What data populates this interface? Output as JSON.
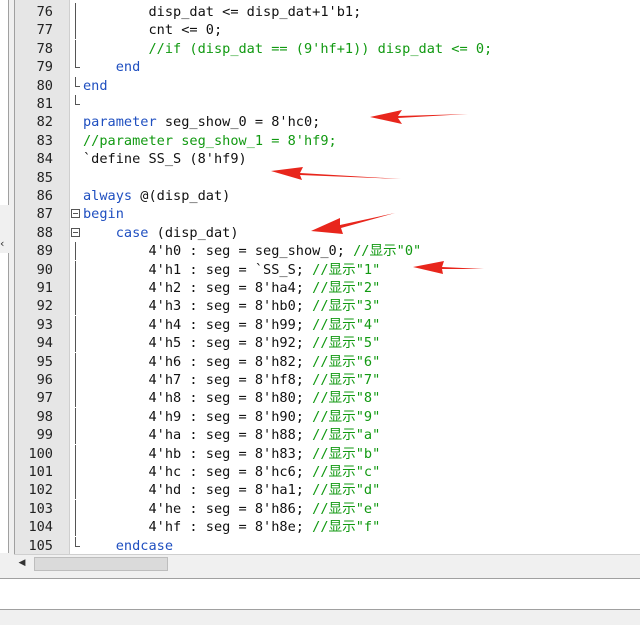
{
  "editor": {
    "lines": [
      {
        "num": "76",
        "fold": "line",
        "segments": [
          {
            "t": "        disp_dat <= disp_dat+1'b1;",
            "c": ""
          }
        ]
      },
      {
        "num": "77",
        "fold": "line",
        "segments": [
          {
            "t": "        cnt <= 0;",
            "c": ""
          }
        ]
      },
      {
        "num": "78",
        "fold": "line",
        "segments": [
          {
            "t": "        //if (disp_dat == (9'hf+1)) disp_dat <= 0;",
            "c": "cm"
          }
        ]
      },
      {
        "num": "79",
        "fold": "end",
        "segments": [
          {
            "t": "    ",
            "c": ""
          },
          {
            "t": "end",
            "c": "kw"
          }
        ]
      },
      {
        "num": "80",
        "fold": "end",
        "segments": [
          {
            "t": "end",
            "c": "kw"
          }
        ]
      },
      {
        "num": "81",
        "fold": "end",
        "segments": []
      },
      {
        "num": "82",
        "fold": "",
        "segments": [
          {
            "t": "parameter",
            "c": "kw"
          },
          {
            "t": " seg_show_0 = 8'hc0;",
            "c": ""
          }
        ]
      },
      {
        "num": "83",
        "fold": "",
        "segments": [
          {
            "t": "//parameter seg_show_1 = 8'hf9;",
            "c": "cm"
          }
        ]
      },
      {
        "num": "84",
        "fold": "",
        "segments": [
          {
            "t": "`define SS_S (8'hf9)",
            "c": ""
          }
        ]
      },
      {
        "num": "85",
        "fold": "",
        "segments": []
      },
      {
        "num": "86",
        "fold": "",
        "segments": [
          {
            "t": "always",
            "c": "kw"
          },
          {
            "t": " @(disp_dat)",
            "c": ""
          }
        ]
      },
      {
        "num": "87",
        "fold": "box",
        "segments": [
          {
            "t": "begin",
            "c": "kw"
          }
        ]
      },
      {
        "num": "88",
        "fold": "box",
        "segments": [
          {
            "t": "    ",
            "c": ""
          },
          {
            "t": "case",
            "c": "kw"
          },
          {
            "t": " (disp_dat)",
            "c": ""
          }
        ]
      },
      {
        "num": "89",
        "fold": "line",
        "segments": [
          {
            "t": "        4'h0 : seg = seg_show_0; ",
            "c": ""
          },
          {
            "t": "//显示\"0\"",
            "c": "cm"
          }
        ]
      },
      {
        "num": "90",
        "fold": "line",
        "segments": [
          {
            "t": "        4'h1 : seg = `SS_S; ",
            "c": ""
          },
          {
            "t": "//显示\"1\"",
            "c": "cm"
          }
        ]
      },
      {
        "num": "91",
        "fold": "line",
        "segments": [
          {
            "t": "        4'h2 : seg = 8'ha4; ",
            "c": ""
          },
          {
            "t": "//显示\"2\"",
            "c": "cm"
          }
        ]
      },
      {
        "num": "92",
        "fold": "line",
        "segments": [
          {
            "t": "        4'h3 : seg = 8'hb0; ",
            "c": ""
          },
          {
            "t": "//显示\"3\"",
            "c": "cm"
          }
        ]
      },
      {
        "num": "93",
        "fold": "line",
        "segments": [
          {
            "t": "        4'h4 : seg = 8'h99; ",
            "c": ""
          },
          {
            "t": "//显示\"4\"",
            "c": "cm"
          }
        ]
      },
      {
        "num": "94",
        "fold": "line",
        "segments": [
          {
            "t": "        4'h5 : seg = 8'h92; ",
            "c": ""
          },
          {
            "t": "//显示\"5\"",
            "c": "cm"
          }
        ]
      },
      {
        "num": "95",
        "fold": "line",
        "segments": [
          {
            "t": "        4'h6 : seg = 8'h82; ",
            "c": ""
          },
          {
            "t": "//显示\"6\"",
            "c": "cm"
          }
        ]
      },
      {
        "num": "96",
        "fold": "line",
        "segments": [
          {
            "t": "        4'h7 : seg = 8'hf8; ",
            "c": ""
          },
          {
            "t": "//显示\"7\"",
            "c": "cm"
          }
        ]
      },
      {
        "num": "97",
        "fold": "line",
        "segments": [
          {
            "t": "        4'h8 : seg = 8'h80; ",
            "c": ""
          },
          {
            "t": "//显示\"8\"",
            "c": "cm"
          }
        ]
      },
      {
        "num": "98",
        "fold": "line",
        "segments": [
          {
            "t": "        4'h9 : seg = 8'h90; ",
            "c": ""
          },
          {
            "t": "//显示\"9\"",
            "c": "cm"
          }
        ]
      },
      {
        "num": "99",
        "fold": "line",
        "segments": [
          {
            "t": "        4'ha : seg = 8'h88; ",
            "c": ""
          },
          {
            "t": "//显示\"a\"",
            "c": "cm"
          }
        ]
      },
      {
        "num": "100",
        "fold": "line",
        "segments": [
          {
            "t": "        4'hb : seg = 8'h83; ",
            "c": ""
          },
          {
            "t": "//显示\"b\"",
            "c": "cm"
          }
        ]
      },
      {
        "num": "101",
        "fold": "line",
        "segments": [
          {
            "t": "        4'hc : seg = 8'hc6; ",
            "c": ""
          },
          {
            "t": "//显示\"c\"",
            "c": "cm"
          }
        ]
      },
      {
        "num": "102",
        "fold": "line",
        "segments": [
          {
            "t": "        4'hd : seg = 8'ha1; ",
            "c": ""
          },
          {
            "t": "//显示\"d\"",
            "c": "cm"
          }
        ]
      },
      {
        "num": "103",
        "fold": "line",
        "segments": [
          {
            "t": "        4'he : seg = 8'h86; ",
            "c": ""
          },
          {
            "t": "//显示\"e\"",
            "c": "cm"
          }
        ]
      },
      {
        "num": "104",
        "fold": "line",
        "segments": [
          {
            "t": "        4'hf : seg = 8'h8e; ",
            "c": ""
          },
          {
            "t": "//显示\"f\"",
            "c": "cm"
          }
        ]
      },
      {
        "num": "105",
        "fold": "end",
        "segments": [
          {
            "t": "    ",
            "c": ""
          },
          {
            "t": "endcase",
            "c": "kw"
          }
        ]
      }
    ]
  },
  "colors": {
    "keyword": "#1f4fc0",
    "comment": "#119911",
    "annotation_arrow": "#e8261c"
  },
  "icons": {
    "scroll_left": "scroll-left-arrow-icon",
    "left_panel_caret": "panel-collapse-caret-icon"
  }
}
